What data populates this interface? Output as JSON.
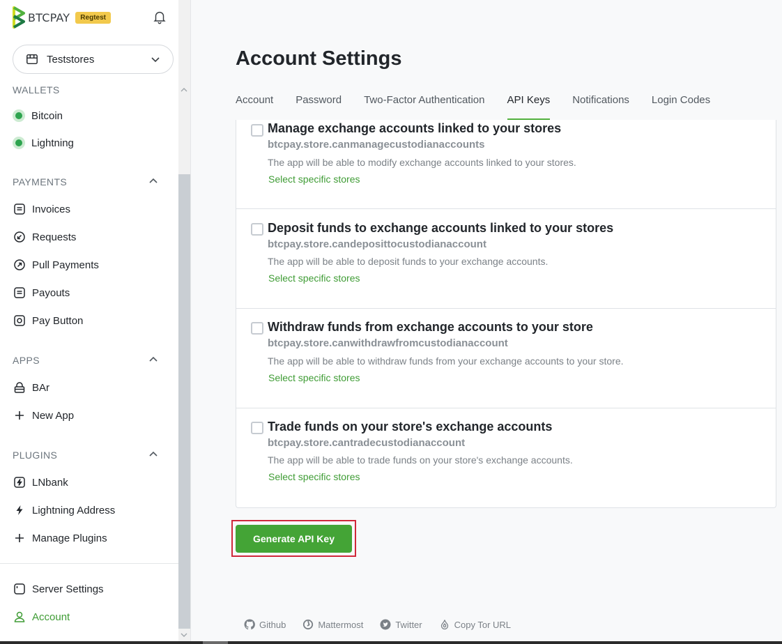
{
  "brand": {
    "name": "BTCPAY",
    "badge": "Regtest"
  },
  "store": {
    "name": "Teststores"
  },
  "sidebar": {
    "wallets": {
      "title": "WALLETS",
      "items": [
        {
          "label": "Bitcoin"
        },
        {
          "label": "Lightning"
        }
      ]
    },
    "payments": {
      "title": "PAYMENTS",
      "items": [
        {
          "label": "Invoices",
          "icon": "invoice-icon"
        },
        {
          "label": "Requests",
          "icon": "requests-icon"
        },
        {
          "label": "Pull Payments",
          "icon": "pull-payments-icon"
        },
        {
          "label": "Payouts",
          "icon": "payouts-icon"
        },
        {
          "label": "Pay Button",
          "icon": "pay-button-icon"
        }
      ]
    },
    "apps": {
      "title": "APPS",
      "items": [
        {
          "label": "BAr",
          "icon": "app-lock-icon"
        },
        {
          "label": "New App",
          "icon": "plus-icon"
        }
      ]
    },
    "plugins": {
      "title": "PLUGINS",
      "items": [
        {
          "label": "LNbank",
          "icon": "lnbank-icon"
        },
        {
          "label": "Lightning Address",
          "icon": "lightning-bolt-icon"
        },
        {
          "label": "Manage Plugins",
          "icon": "plus-icon"
        }
      ]
    },
    "bottom": [
      {
        "label": "Server Settings",
        "icon": "server-icon"
      },
      {
        "label": "Account",
        "icon": "user-icon"
      }
    ]
  },
  "main": {
    "title": "Account Settings",
    "tabs": [
      {
        "label": "Account"
      },
      {
        "label": "Password"
      },
      {
        "label": "Two-Factor Authentication"
      },
      {
        "label": "API Keys",
        "active": true
      },
      {
        "label": "Notifications"
      },
      {
        "label": "Login Codes"
      }
    ],
    "permissions": [
      {
        "title": "Manage exchange accounts linked to your stores",
        "key": "btcpay.store.canmanagecustodianaccounts",
        "description": "The app will be able to modify exchange accounts linked to your stores.",
        "link": "Select specific stores",
        "checked": false
      },
      {
        "title": "Deposit funds to exchange accounts linked to your stores",
        "key": "btcpay.store.candeposittocustodianaccount",
        "description": "The app will be able to deposit funds to your exchange accounts.",
        "link": "Select specific stores",
        "checked": false
      },
      {
        "title": "Withdraw funds from exchange accounts to your store",
        "key": "btcpay.store.canwithdrawfromcustodianaccount",
        "description": "The app will be able to withdraw funds from your exchange accounts to your store.",
        "link": "Select specific stores",
        "checked": false
      },
      {
        "title": "Trade funds on your store's exchange accounts",
        "key": "btcpay.store.cantradecustodianaccount",
        "description": "The app will be able to trade funds on your store's exchange accounts.",
        "link": "Select specific stores",
        "checked": false
      }
    ],
    "generate_button": "Generate API Key"
  },
  "footer": {
    "links": [
      {
        "label": "Github",
        "icon": "github-icon"
      },
      {
        "label": "Mattermost",
        "icon": "mattermost-icon"
      },
      {
        "label": "Twitter",
        "icon": "twitter-icon"
      },
      {
        "label": "Copy Tor URL",
        "icon": "tor-icon"
      }
    ]
  },
  "colors": {
    "accent": "#44a436",
    "highlight": "#d0283a",
    "badge": "#f2c94c"
  }
}
